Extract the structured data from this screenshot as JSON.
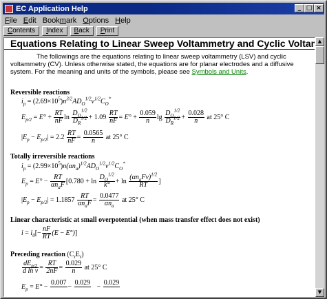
{
  "window": {
    "title": "EC Application Help"
  },
  "menu": {
    "file": {
      "pre": "",
      "key": "F",
      "post": "ile"
    },
    "edit": {
      "pre": "",
      "key": "E",
      "post": "dit"
    },
    "bookmark": {
      "pre": "Book",
      "key": "m",
      "post": "ark"
    },
    "options": {
      "pre": "",
      "key": "O",
      "post": "ptions"
    },
    "help": {
      "pre": "",
      "key": "H",
      "post": "elp"
    }
  },
  "toolbar": {
    "contents": {
      "key": "C",
      "post": "ontents"
    },
    "index": {
      "key": "I",
      "post": "ndex"
    },
    "back": {
      "key": "B",
      "post": "ack"
    },
    "print": {
      "key": "P",
      "post": "rint"
    }
  },
  "page": {
    "heading": "Equations Relating to Linear Sweep Voltammetry and Cyclic Voltammetry",
    "intro_1": "The followings are the equations relating to linear sweep voltammetry (LSV) and cyclic voltammetry (CV). Unless otherwise stated, the equations are for planar electrodes and a diffusive system. For the meaning and units of the symbols, please see ",
    "intro_link": "Symbols and Units",
    "intro_2": ".",
    "sections": {
      "reversible": "Reversible reactions",
      "irreversible": "Totally irreversible reactions",
      "linear": "Linear characteristic at small overpotential (when mass transfer effect does not exist)",
      "preceding": "Preceding reaction"
    }
  }
}
